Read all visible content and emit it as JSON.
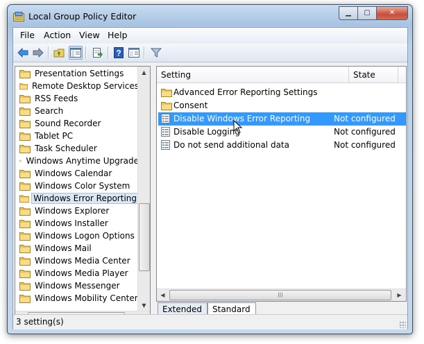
{
  "window": {
    "title": "Local Group Policy Editor"
  },
  "menu": [
    "File",
    "Action",
    "View",
    "Help"
  ],
  "toolbar": {
    "buttons": [
      "back-arrow-icon",
      "forward-arrow-icon",
      "up-folder-icon",
      "show-hide-tree-icon",
      "export-list-icon",
      "help-icon",
      "properties-icon",
      "filter-icon"
    ]
  },
  "tree": {
    "items": [
      "Presentation Settings",
      "Remote Desktop Services",
      "RSS Feeds",
      "Search",
      "Sound Recorder",
      "Tablet PC",
      "Task Scheduler",
      "Windows Anytime Upgrade",
      "Windows Calendar",
      "Windows Color System",
      "Windows Error Reporting",
      "Windows Explorer",
      "Windows Installer",
      "Windows Logon Options",
      "Windows Mail",
      "Windows Media Center",
      "Windows Media Player",
      "Windows Messenger",
      "Windows Mobility Center"
    ],
    "selected": "Windows Error Reporting"
  },
  "list": {
    "columns": {
      "setting": "Setting",
      "state": "State"
    },
    "rows": [
      {
        "name": "Advanced Error Reporting Settings",
        "state": "",
        "type": "folder"
      },
      {
        "name": "Consent",
        "state": "",
        "type": "folder"
      },
      {
        "name": "Disable Windows Error Reporting",
        "state": "Not configured",
        "type": "setting",
        "selected": true
      },
      {
        "name": "Disable Logging",
        "state": "Not configured",
        "type": "setting"
      },
      {
        "name": "Do not send additional data",
        "state": "Not configured",
        "type": "setting"
      }
    ]
  },
  "tabs": {
    "extended": "Extended",
    "standard": "Standard",
    "active": "Standard"
  },
  "status": {
    "text": "3 setting(s)"
  },
  "colors": {
    "selection": "#3399ff",
    "folder": "#e8c25a",
    "accent": "#1f5fae"
  }
}
